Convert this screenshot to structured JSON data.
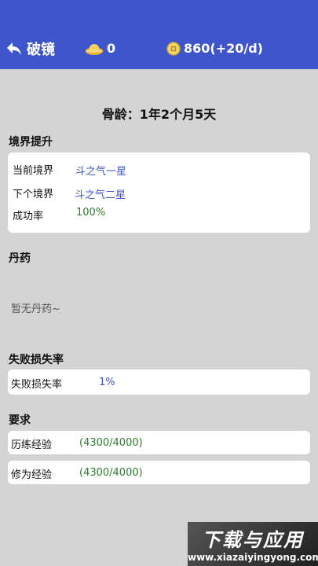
{
  "header": {
    "back_title": "破镜",
    "gold_amount": "0",
    "coin_amount": "860(+20/d)"
  },
  "age_label": "骨龄：1年2个月5天",
  "realm": {
    "section_title": "境界提升",
    "rows": [
      {
        "label": "当前境界",
        "value": "斗之气一星"
      },
      {
        "label": "下个境界",
        "value": "斗之气二星"
      },
      {
        "label": "成功率",
        "value": "100%"
      }
    ]
  },
  "pills": {
    "section_title": "丹药",
    "empty_text": "暂无丹药~"
  },
  "failure": {
    "section_title": "失败损失率",
    "label": "失败损失率",
    "value": "1%"
  },
  "requirements": {
    "section_title": "要求",
    "items": [
      {
        "label": "历练经验",
        "value": "(4300/4000)"
      },
      {
        "label": "修为经验",
        "value": "(4300/4000)"
      }
    ]
  },
  "watermark": {
    "title": "下载与应用",
    "url": "www.xiazaiyingyong.com"
  },
  "colors": {
    "header_bg": "#3f55cc",
    "content_bg": "#d4d4d4",
    "value_blue": "#3d56c5",
    "value_green": "#2c7c2c"
  }
}
